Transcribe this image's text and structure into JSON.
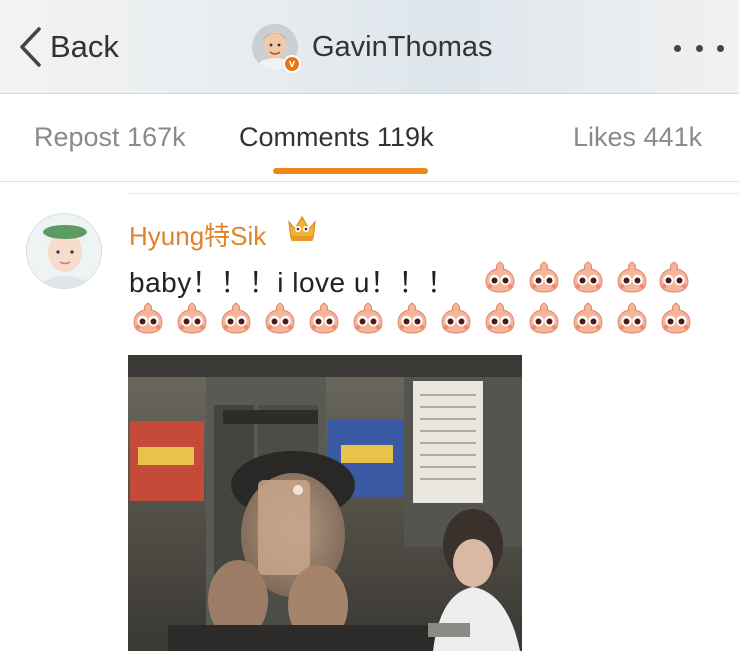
{
  "navbar": {
    "back_label": "Back",
    "username": "GavinThomas",
    "verified_badge": "v"
  },
  "tabs": {
    "repost": "Repost 167k",
    "comments": "Comments 119k",
    "likes": "Likes 441k",
    "active": "comments",
    "accent_color": "#f0851a"
  },
  "comment": {
    "author": "Hyung特Sik",
    "author_color": "#e2822b",
    "text": "baby！！！i love u！！！",
    "badge_icon": "crown-icon",
    "emoji_icon": "peach-emoji-icon",
    "emoji_count": 18
  },
  "attachment": {
    "type": "photo",
    "description": "selfie-in-elevator",
    "sign_text": "Sign"
  }
}
